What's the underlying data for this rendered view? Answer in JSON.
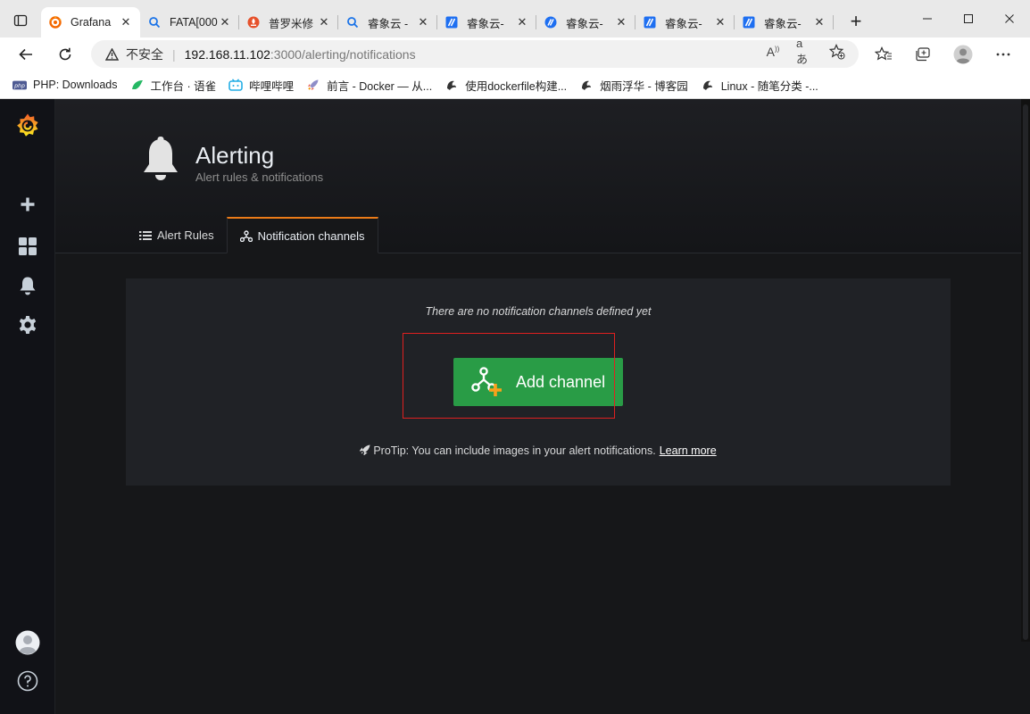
{
  "browser": {
    "tabs": [
      {
        "title": "Grafana",
        "icon": "grafana-icon",
        "active": true
      },
      {
        "title": "FATA[000",
        "icon": "search-icon"
      },
      {
        "title": "普罗米修",
        "icon": "fire-icon"
      },
      {
        "title": "睿象云 -",
        "icon": "search-icon"
      },
      {
        "title": "睿象云-",
        "icon": "ruixiang-icon"
      },
      {
        "title": "睿象云-",
        "icon": "ruixiang-icon"
      },
      {
        "title": "睿象云-",
        "icon": "ruixiang-icon"
      },
      {
        "title": "睿象云-",
        "icon": "ruixiang-icon"
      }
    ],
    "new_tab_label": "+",
    "address": {
      "insecure_label": "不安全",
      "host": "192.168.11.102",
      "path": ":3000/alerting/notifications"
    },
    "bookmarks": [
      {
        "label": "PHP: Downloads",
        "icon": "php-icon"
      },
      {
        "label": "工作台 · 语雀",
        "icon": "yuque-icon"
      },
      {
        "label": "哔哩哔哩",
        "icon": "bilibili-icon"
      },
      {
        "label": "前言 - Docker — 从...",
        "icon": "rocket-icon"
      },
      {
        "label": "使用dockerfile构建...",
        "icon": "cnblogs-icon"
      },
      {
        "label": "烟雨浮华 - 博客园",
        "icon": "cnblogs-icon"
      },
      {
        "label": "Linux - 随笔分类 -...",
        "icon": "cnblogs-icon"
      }
    ]
  },
  "grafana": {
    "header": {
      "title": "Alerting",
      "subtitle": "Alert rules & notifications"
    },
    "tabs": [
      {
        "label": "Alert Rules",
        "icon": "list-icon",
        "active": false
      },
      {
        "label": "Notification channels",
        "icon": "channels-icon",
        "active": true
      }
    ],
    "empty_state": {
      "message": "There are no notification channels defined yet",
      "button_label": "Add channel",
      "protip": "ProTip: You can include images in your alert notifications.",
      "learn_more": "Learn more"
    }
  },
  "colors": {
    "accent_orange": "#eb7b18",
    "button_green": "#299c46",
    "highlight_red": "#e02020",
    "panel_bg": "#202226",
    "page_bg": "#161719"
  }
}
